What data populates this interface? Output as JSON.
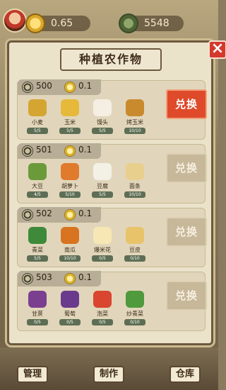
{
  "topbar": {
    "coins_value": "0.65",
    "tokens_value": "5548"
  },
  "modal": {
    "title": "种植农作物",
    "close_label": "×"
  },
  "cards": [
    {
      "cost_primary": "500",
      "cost_secondary": "0.1",
      "button_label": "兑换",
      "button_state": "enabled",
      "items": [
        {
          "name": "小麦",
          "count": "5/5",
          "icon": "wheat-icon",
          "color": "#d4a531"
        },
        {
          "name": "玉米",
          "count": "5/5",
          "icon": "corn-icon",
          "color": "#e6b93a"
        },
        {
          "name": "馒头",
          "count": "5/5",
          "icon": "steamed-bun-icon",
          "color": "#f4efe2"
        },
        {
          "name": "烤玉米",
          "count": "10/10",
          "icon": "roasted-corn-icon",
          "color": "#c98a2e"
        }
      ]
    },
    {
      "cost_primary": "501",
      "cost_secondary": "0.1",
      "button_label": "兑换",
      "button_state": "disabled",
      "items": [
        {
          "name": "大豆",
          "count": "4/5",
          "icon": "soybean-icon",
          "color": "#6b9a3a"
        },
        {
          "name": "胡萝卜",
          "count": "5/10",
          "icon": "carrot-icon",
          "color": "#e07a2c"
        },
        {
          "name": "豆腐",
          "count": "5/5",
          "icon": "tofu-icon",
          "color": "#f3f0e6"
        },
        {
          "name": "面条",
          "count": "10/10",
          "icon": "noodles-icon",
          "color": "#e9cf8e"
        }
      ]
    },
    {
      "cost_primary": "502",
      "cost_secondary": "0.1",
      "button_label": "兑换",
      "button_state": "disabled",
      "items": [
        {
          "name": "青菜",
          "count": "5/5",
          "icon": "greens-icon",
          "color": "#3f8a3a"
        },
        {
          "name": "南瓜",
          "count": "10/10",
          "icon": "pumpkin-icon",
          "color": "#d8731f"
        },
        {
          "name": "爆米花",
          "count": "0/5",
          "icon": "popcorn-icon",
          "color": "#f6e7b4"
        },
        {
          "name": "豆皮",
          "count": "0/10",
          "icon": "tofu-skin-icon",
          "color": "#e8c36a"
        }
      ]
    },
    {
      "cost_primary": "503",
      "cost_secondary": "0.1",
      "button_label": "兑换",
      "button_state": "disabled",
      "items": [
        {
          "name": "甘蔗",
          "count": "0/5",
          "icon": "sugarcane-icon",
          "color": "#7b3f8f"
        },
        {
          "name": "葡萄",
          "count": "0/5",
          "icon": "grape-icon",
          "color": "#6a3a8c"
        },
        {
          "name": "泡菜",
          "count": "0/5",
          "icon": "kimchi-icon",
          "color": "#d9452f"
        },
        {
          "name": "炒青菜",
          "count": "0/10",
          "icon": "fried-greens-icon",
          "color": "#4f9a3c"
        }
      ]
    }
  ],
  "nav": {
    "manage": "管理",
    "make": "制作",
    "warehouse": "仓库"
  }
}
